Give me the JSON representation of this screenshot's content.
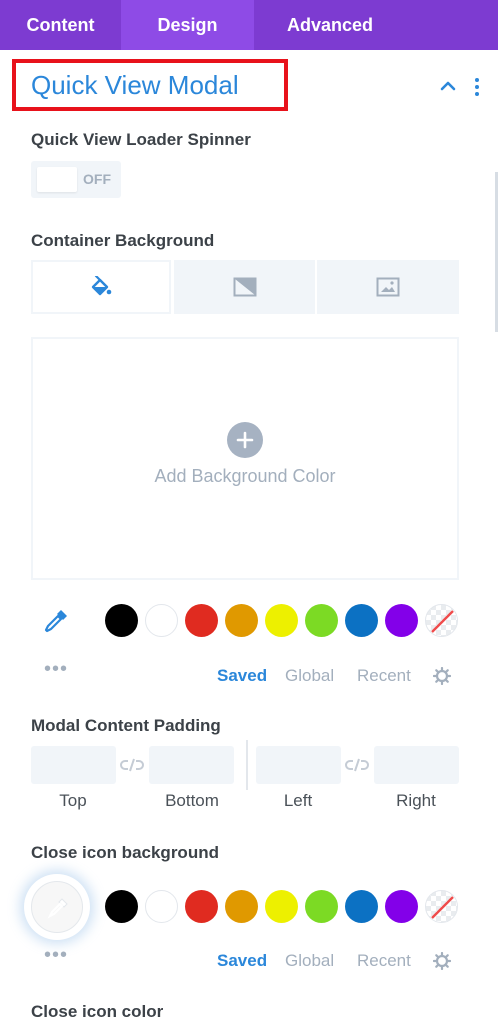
{
  "tabs": [
    {
      "label": "Content",
      "active": false
    },
    {
      "label": "Design",
      "active": true
    },
    {
      "label": "Advanced",
      "active": false
    }
  ],
  "section": {
    "title": "Quick View Modal",
    "caret_icon": "chevron-up-icon",
    "menu_icon": "kebab-icon"
  },
  "spinner": {
    "label": "Quick View Loader Spinner",
    "state": "OFF"
  },
  "container_bg": {
    "label": "Container Background",
    "types": [
      "color-fill-icon",
      "gradient-icon",
      "image-icon"
    ],
    "add_label": "Add Background Color"
  },
  "palette": {
    "colors": [
      "#000000",
      "#ffffff",
      "#e02b20",
      "#e09900",
      "#edf000",
      "#7cda24",
      "#0c71c3",
      "#8300e9",
      "transparent"
    ],
    "tabs": [
      "Saved",
      "Global",
      "Recent"
    ],
    "active_tab": "Saved"
  },
  "padding": {
    "label": "Modal Content Padding",
    "sides": [
      "Top",
      "Bottom",
      "Left",
      "Right"
    ]
  },
  "close_bg": {
    "label": "Close icon background"
  },
  "close_color": {
    "label": "Close icon color"
  },
  "colors": {
    "accent": "#2b87da",
    "tab_bar": "#7d3bd1",
    "highlight_box": "#e8121b"
  }
}
